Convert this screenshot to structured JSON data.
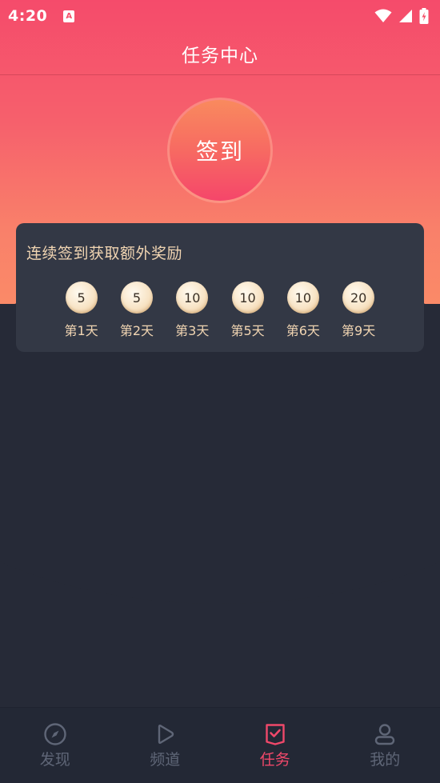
{
  "status_bar": {
    "time": "4:20",
    "app_icon_letter": "A"
  },
  "header": {
    "title": "任务中心"
  },
  "checkin": {
    "button_label": "签到"
  },
  "reward_card": {
    "title": "连续签到获取额外奖励",
    "days": [
      {
        "points": "5",
        "label": "第1天"
      },
      {
        "points": "5",
        "label": "第2天"
      },
      {
        "points": "10",
        "label": "第3天"
      },
      {
        "points": "10",
        "label": "第5天"
      },
      {
        "points": "10",
        "label": "第6天"
      },
      {
        "points": "20",
        "label": "第9天"
      }
    ]
  },
  "bottom_nav": {
    "items": [
      {
        "label": "发现",
        "icon": "compass-icon"
      },
      {
        "label": "频道",
        "icon": "play-icon"
      },
      {
        "label": "任务",
        "icon": "task-check-icon"
      },
      {
        "label": "我的",
        "icon": "user-icon"
      }
    ],
    "active_index": 2
  },
  "colors": {
    "accent": "#f0486a",
    "background": "#262a37",
    "card": "#333845",
    "reward_text": "#f1d5b2",
    "nav_inactive": "#5f6677"
  }
}
